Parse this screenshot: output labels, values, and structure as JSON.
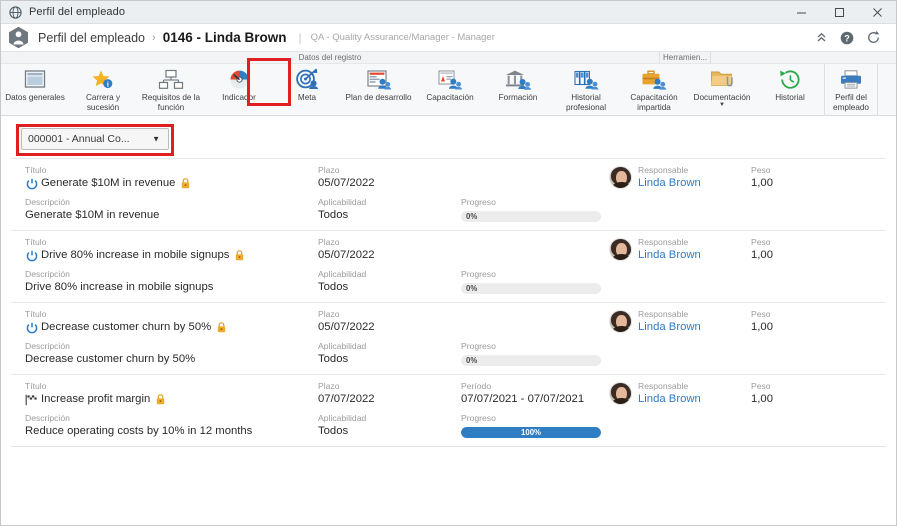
{
  "window": {
    "title": "Perfil del empleado",
    "icon": "globe-icon",
    "minimize": "—",
    "maximize": "□",
    "close": "✕"
  },
  "header": {
    "breadcrumb_root": "Perfil del empleado",
    "breadcrumb_sep": "›",
    "breadcrumb_current": "0146 - Linda Brown",
    "pipe": "|",
    "subtitle": "QA - Quality Assurance/Manager - Manager",
    "collapse_icon": "«",
    "help_icon": "?",
    "refresh_icon": "↻"
  },
  "ribbon": {
    "group_main_label": "Datos del registro",
    "group_tools_label": "Herramien...",
    "buttons": [
      {
        "label": "Datos generales",
        "icon": "window-form-icon",
        "selected": false
      },
      {
        "label": "Carrera y sucesión",
        "icon": "star-info-icon",
        "selected": false
      },
      {
        "label": "Requisitos de la función",
        "icon": "org-chart-icon",
        "selected": false
      },
      {
        "label": "Indicador",
        "icon": "gauge-icon",
        "selected": false
      },
      {
        "label": "Meta",
        "icon": "target-arrow-icon",
        "selected": true
      },
      {
        "label": "Plan de desarrollo",
        "icon": "plan-people-icon",
        "selected": false
      },
      {
        "label": "Capacitación",
        "icon": "bank-people-icon",
        "selected": false
      },
      {
        "label": "Formación",
        "icon": "bank-columns-icon",
        "selected": false
      },
      {
        "label": "Historial profesional",
        "icon": "books-people-icon",
        "selected": false
      },
      {
        "label": "Capacitación impartida",
        "icon": "briefcase-people-icon",
        "selected": false
      },
      {
        "label": "Documentación",
        "icon": "folder-clip-icon",
        "selected": false,
        "caret": "▼"
      },
      {
        "label": "Historial",
        "icon": "clock-rewind-icon",
        "selected": false
      }
    ],
    "tools_buttons": [
      {
        "label": "Perfil del empleado",
        "icon": "printer-icon"
      }
    ]
  },
  "selector": {
    "value": "000001 - Annual Co...",
    "caret": "▼"
  },
  "labels": {
    "titulo": "Título",
    "descripcion": "Descripción",
    "plazo": "Plazo",
    "aplicabilidad": "Aplicabilidad",
    "periodo": "Período",
    "progreso": "Progreso",
    "responsable": "Responsable",
    "peso": "Peso"
  },
  "colors": {
    "accent_blue": "#2f7dc2",
    "link_blue": "#2e7cc4",
    "highlight_red": "#e02020",
    "lock_orange": "#e8a020"
  },
  "goals": [
    {
      "title": "Generate $10M in revenue",
      "title_icon": "power-circle-icon",
      "locked": true,
      "descripcion": "Generate $10M in revenue",
      "plazo": "05/07/2022",
      "aplicabilidad": "Todos",
      "periodo": null,
      "progreso": "0%",
      "progreso_value": 0,
      "responsable": "Linda Brown",
      "peso": "1,00"
    },
    {
      "title": "Drive 80% increase in mobile signups",
      "title_icon": "power-circle-icon",
      "locked": true,
      "descripcion": "Drive 80% increase in mobile signups",
      "plazo": "05/07/2022",
      "aplicabilidad": "Todos",
      "periodo": null,
      "progreso": "0%",
      "progreso_value": 0,
      "responsable": "Linda Brown",
      "peso": "1,00"
    },
    {
      "title": "Decrease customer churn by 50%",
      "title_icon": "power-circle-icon",
      "locked": true,
      "descripcion": "Decrease customer churn by 50%",
      "plazo": "05/07/2022",
      "aplicabilidad": "Todos",
      "periodo": null,
      "progreso": "0%",
      "progreso_value": 0,
      "responsable": "Linda Brown",
      "peso": "1,00"
    },
    {
      "title": "Increase profit margin",
      "title_icon": "checkered-flag-icon",
      "locked": true,
      "descripcion": "Reduce operating costs by 10% in 12 months",
      "plazo": "07/07/2022",
      "aplicabilidad": "Todos",
      "periodo": "07/07/2021 - 07/07/2021",
      "progreso": "100%",
      "progreso_value": 100,
      "responsable": "Linda Brown",
      "peso": "1,00"
    }
  ]
}
